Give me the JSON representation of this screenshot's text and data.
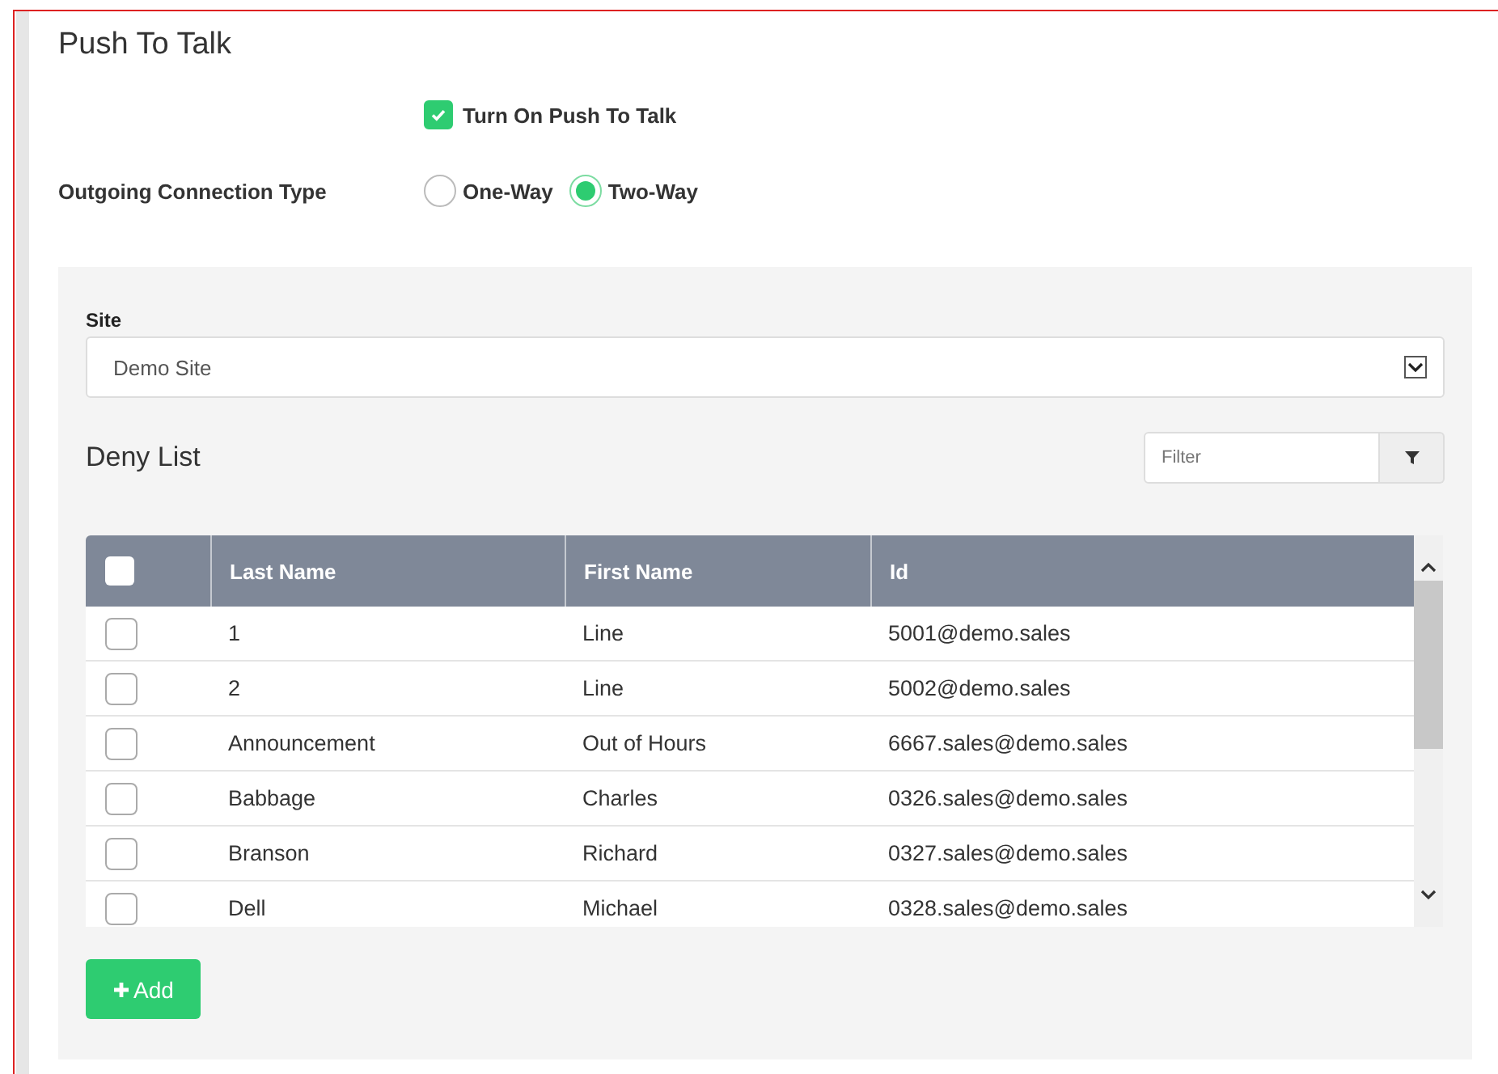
{
  "title": "Push To Talk",
  "enable": {
    "label": "Turn On Push To Talk",
    "checked": true
  },
  "connection": {
    "label": "Outgoing Connection Type",
    "options": [
      {
        "label": "One-Way",
        "selected": false
      },
      {
        "label": "Two-Way",
        "selected": true
      }
    ]
  },
  "site": {
    "label": "Site",
    "value": "Demo Site"
  },
  "deny_list": {
    "title": "Deny List",
    "filter": {
      "placeholder": "Filter"
    },
    "header_checked": false,
    "columns": [
      "Last Name",
      "First Name",
      "Id"
    ],
    "rows": [
      {
        "checked": false,
        "cells": [
          "1",
          "Line",
          "5001@demo.sales"
        ]
      },
      {
        "checked": false,
        "cells": [
          "2",
          "Line",
          "5002@demo.sales"
        ]
      },
      {
        "checked": false,
        "cells": [
          "Announcement",
          "Out of Hours",
          "6667.sales@demo.sales"
        ]
      },
      {
        "checked": false,
        "cells": [
          "Babbage",
          "Charles",
          "0326.sales@demo.sales"
        ]
      },
      {
        "checked": false,
        "cells": [
          "Branson",
          "Richard",
          "0327.sales@demo.sales"
        ]
      },
      {
        "checked": false,
        "cells": [
          "Dell",
          "Michael",
          "0328.sales@demo.sales"
        ]
      }
    ],
    "add_button": "Add"
  }
}
